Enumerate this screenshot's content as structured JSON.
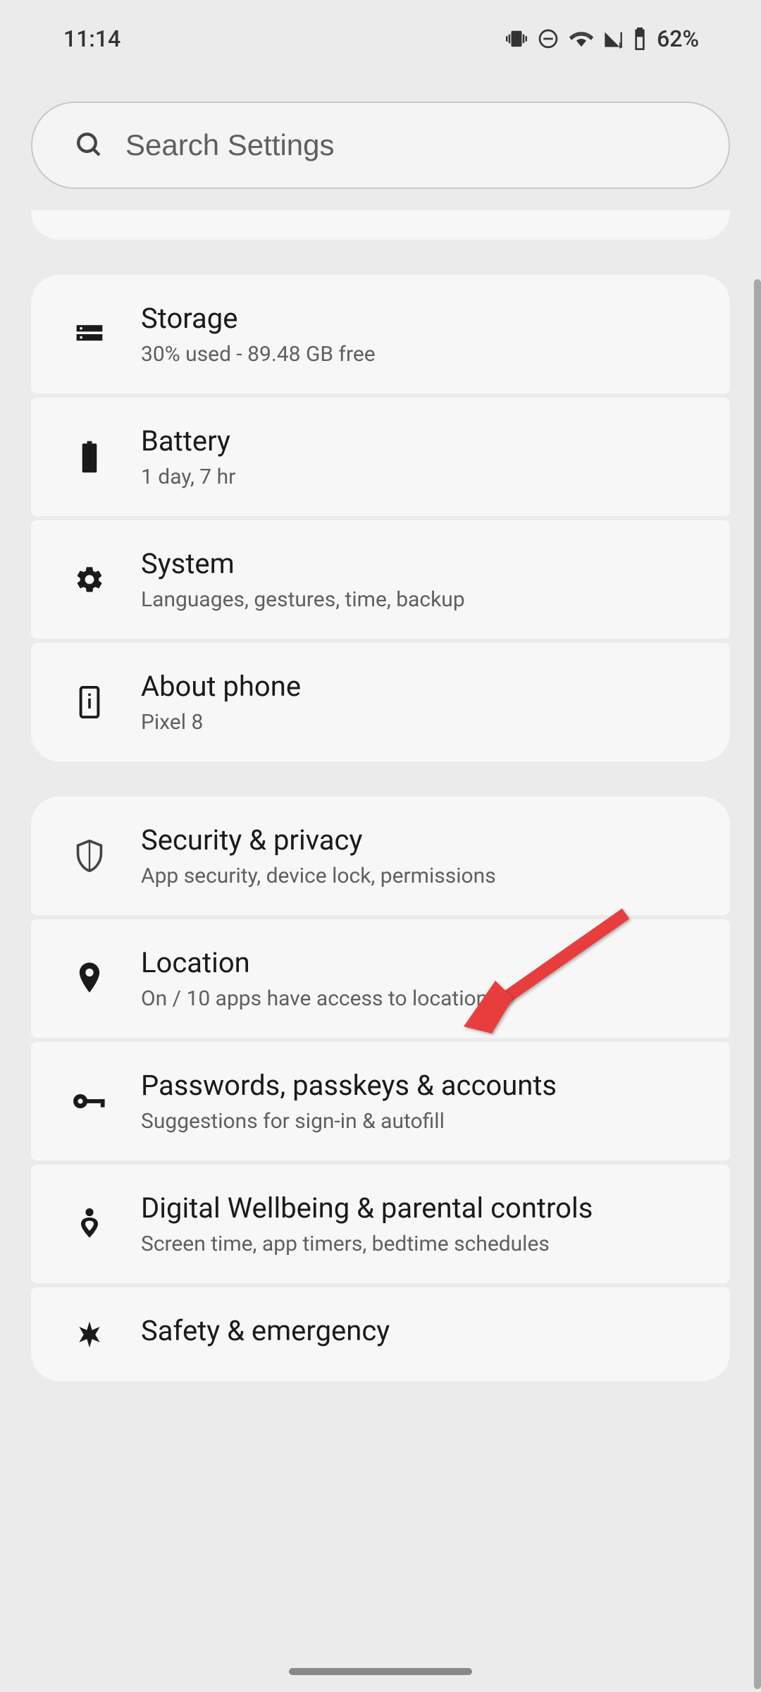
{
  "status": {
    "time": "11:14",
    "battery_percent": "62%"
  },
  "search": {
    "placeholder": "Search Settings"
  },
  "items": [
    {
      "title": "Storage",
      "subtitle": "30% used - 89.48 GB free"
    },
    {
      "title": "Battery",
      "subtitle": "1 day, 7 hr"
    },
    {
      "title": "System",
      "subtitle": "Languages, gestures, time, backup"
    },
    {
      "title": "About phone",
      "subtitle": "Pixel 8"
    },
    {
      "title": "Security & privacy",
      "subtitle": "App security, device lock, permissions"
    },
    {
      "title": "Location",
      "subtitle": "On / 10 apps have access to location"
    },
    {
      "title": "Passwords, passkeys & accounts",
      "subtitle": "Suggestions for sign-in & autofill"
    },
    {
      "title": "Digital Wellbeing & parental controls",
      "subtitle": "Screen time, app timers, bedtime schedules"
    },
    {
      "title": "Safety & emergency",
      "subtitle": ""
    }
  ]
}
